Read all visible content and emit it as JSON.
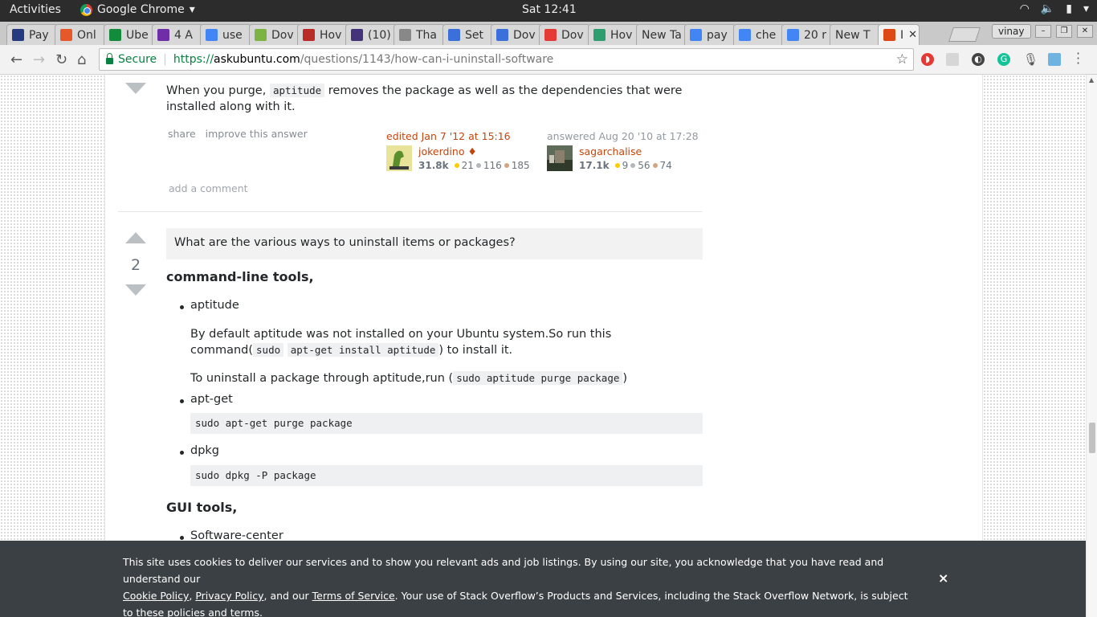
{
  "os": {
    "activities": "Activities",
    "app_name": "Google Chrome",
    "clock": "Sat 12:41"
  },
  "tabs": [
    {
      "label": "Pay",
      "icon": "paypal-icon",
      "color": "#253b80"
    },
    {
      "label": "Onl",
      "icon": "shopping-bag-icon",
      "color": "#e8572a"
    },
    {
      "label": "Ube",
      "icon": "upwork-icon",
      "color": "#128c3a"
    },
    {
      "label": "4 A",
      "icon": "gc-icon",
      "color": "#6f2da8"
    },
    {
      "label": "use",
      "icon": "google-icon",
      "color": "#4285f4"
    },
    {
      "label": "Dov",
      "icon": "layers-icon",
      "color": "#7cb342"
    },
    {
      "label": "Hov",
      "icon": "quora-icon",
      "color": "#b92b27"
    },
    {
      "label": "(10)",
      "icon": "protonmail-icon",
      "color": "#44337a"
    },
    {
      "label": "Tha",
      "icon": "page-icon",
      "color": "#888888"
    },
    {
      "label": "Set",
      "icon": "settings-icon",
      "color": "#3b6fd9"
    },
    {
      "label": "Dov",
      "icon": "download-icon",
      "color": "#3b6fd9"
    },
    {
      "label": "Dov",
      "icon": "link-icon",
      "color": "#e53935"
    },
    {
      "label": "Hov",
      "icon": "android-icon",
      "color": "#2e9e6e"
    },
    {
      "label": "New Ta",
      "icon": "",
      "color": ""
    },
    {
      "label": "pay",
      "icon": "google-icon",
      "color": "#4285f4"
    },
    {
      "label": "che",
      "icon": "google-icon",
      "color": "#4285f4"
    },
    {
      "label": "20 r",
      "icon": "google-icon",
      "color": "#4285f4"
    },
    {
      "label": "New T",
      "icon": "",
      "color": ""
    },
    {
      "label": "I",
      "icon": "askubuntu-icon",
      "color": "#dd4814",
      "active": true
    }
  ],
  "profile": "vinay",
  "address": {
    "secure_label": "Secure",
    "scheme": "https://",
    "host": "askubuntu.com",
    "path": "/questions/1143/how-can-i-uninstall-software"
  },
  "answer1": {
    "text_before": "When you purge, ",
    "code": "aptitude",
    "text_after": " removes the package as well as the dependencies that were installed along with it.",
    "menu": [
      "share",
      "improve this answer"
    ],
    "edited": {
      "action": "edited Jan 7 '12 at 15:16",
      "user": "jokerdino ♦",
      "rep": "31.8k",
      "gold": "21",
      "silver": "116",
      "bronze": "185"
    },
    "answered": {
      "action": "answered Aug 20 '10 at 17:28",
      "user": "sagarchalise",
      "rep": "17.1k",
      "gold": "9",
      "silver": "56",
      "bronze": "74"
    },
    "add_comment": "add a comment"
  },
  "answer2": {
    "votes": "2",
    "quote": "What are the various ways to uninstall items or packages?",
    "heading_cli": "command-line tools,",
    "aptitude": {
      "label": "aptitude",
      "p1_before": "By default aptitude was not installed on your Ubuntu system.So run this command(",
      "p1_code_a": "sudo",
      "p1_code_b": "apt-get install aptitude",
      "p1_after": ") to install it.",
      "p2_before": "To uninstall a package through aptitude,run (",
      "p2_code": "sudo aptitude purge package",
      "p2_after": ")"
    },
    "apt_get": {
      "label": "apt-get",
      "code": "sudo apt-get purge package"
    },
    "dpkg": {
      "label": "dpkg",
      "code": "sudo dpkg -P package"
    },
    "heading_gui": "GUI tools,",
    "software_center": "Software-center"
  },
  "cookie": {
    "line1": "This site uses cookies to deliver our services and to show you relevant ads and job listings. By using our site, you acknowledge that you have read and understand our",
    "cookie_policy": "Cookie Policy",
    "comma": ",",
    "privacy_policy": "Privacy Policy",
    "and_our": ", and our",
    "terms": "Terms of Service",
    "line2_after": ". Your use of Stack Overflow’s Products and Services, including the Stack Overflow Network, is subject to these policies and terms.",
    "close": "×"
  },
  "colors": {
    "accent_orange": "#c4450d",
    "secure_green": "#0b8043",
    "banner": "#3b4045"
  }
}
